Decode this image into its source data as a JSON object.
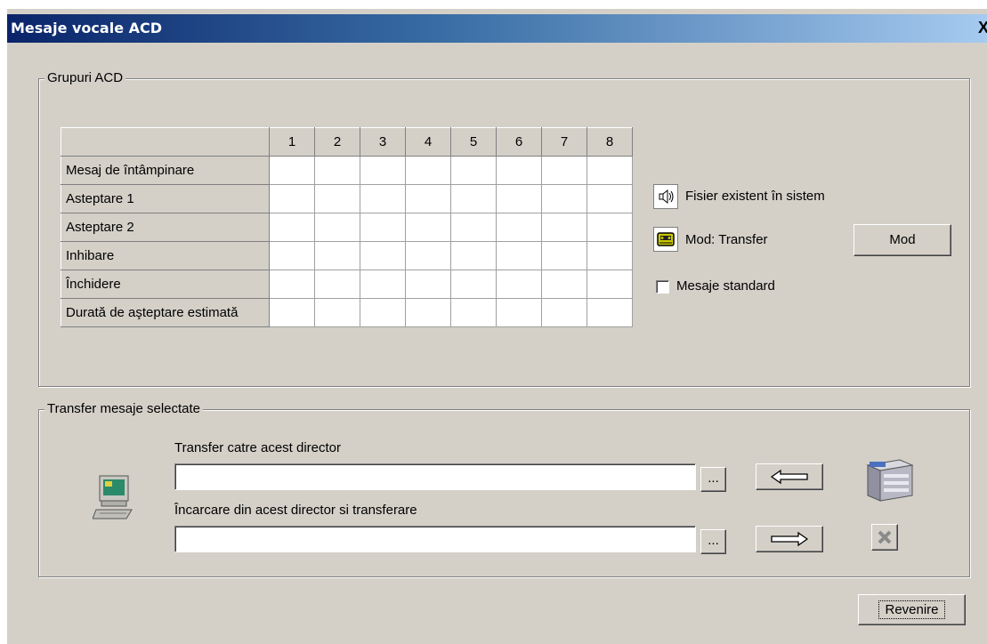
{
  "window": {
    "title": "Mesaje vocale ACD",
    "close_glyph": "X"
  },
  "groups_acd": {
    "legend": "Grupuri ACD",
    "columns": [
      "1",
      "2",
      "3",
      "4",
      "5",
      "6",
      "7",
      "8"
    ],
    "rows": [
      "Mesaj de întâmpinare",
      "Asteptare 1",
      "Asteptare 2",
      "Inhibare",
      "Închidere",
      "Durată de aşteptare estimată"
    ],
    "file_exists_label": "Fisier existent în sistem",
    "mode_label": "Mod: Transfer",
    "mode_button": "Mod",
    "standard_checkbox_label": "Mesaje standard",
    "standard_checked": false
  },
  "transfer": {
    "legend": "Transfer mesaje selectate",
    "to_dir_label": "Transfer catre acest director",
    "to_dir_value": "",
    "from_dir_label": "Încarcare din acest director si transferare",
    "from_dir_value": "",
    "browse_label": "..."
  },
  "footer": {
    "back_button": "Revenire"
  },
  "icons": [
    "speaker-icon",
    "tape-icon",
    "computer-icon",
    "server-icon",
    "delete-icon",
    "arrow-left-icon",
    "arrow-right-icon"
  ]
}
